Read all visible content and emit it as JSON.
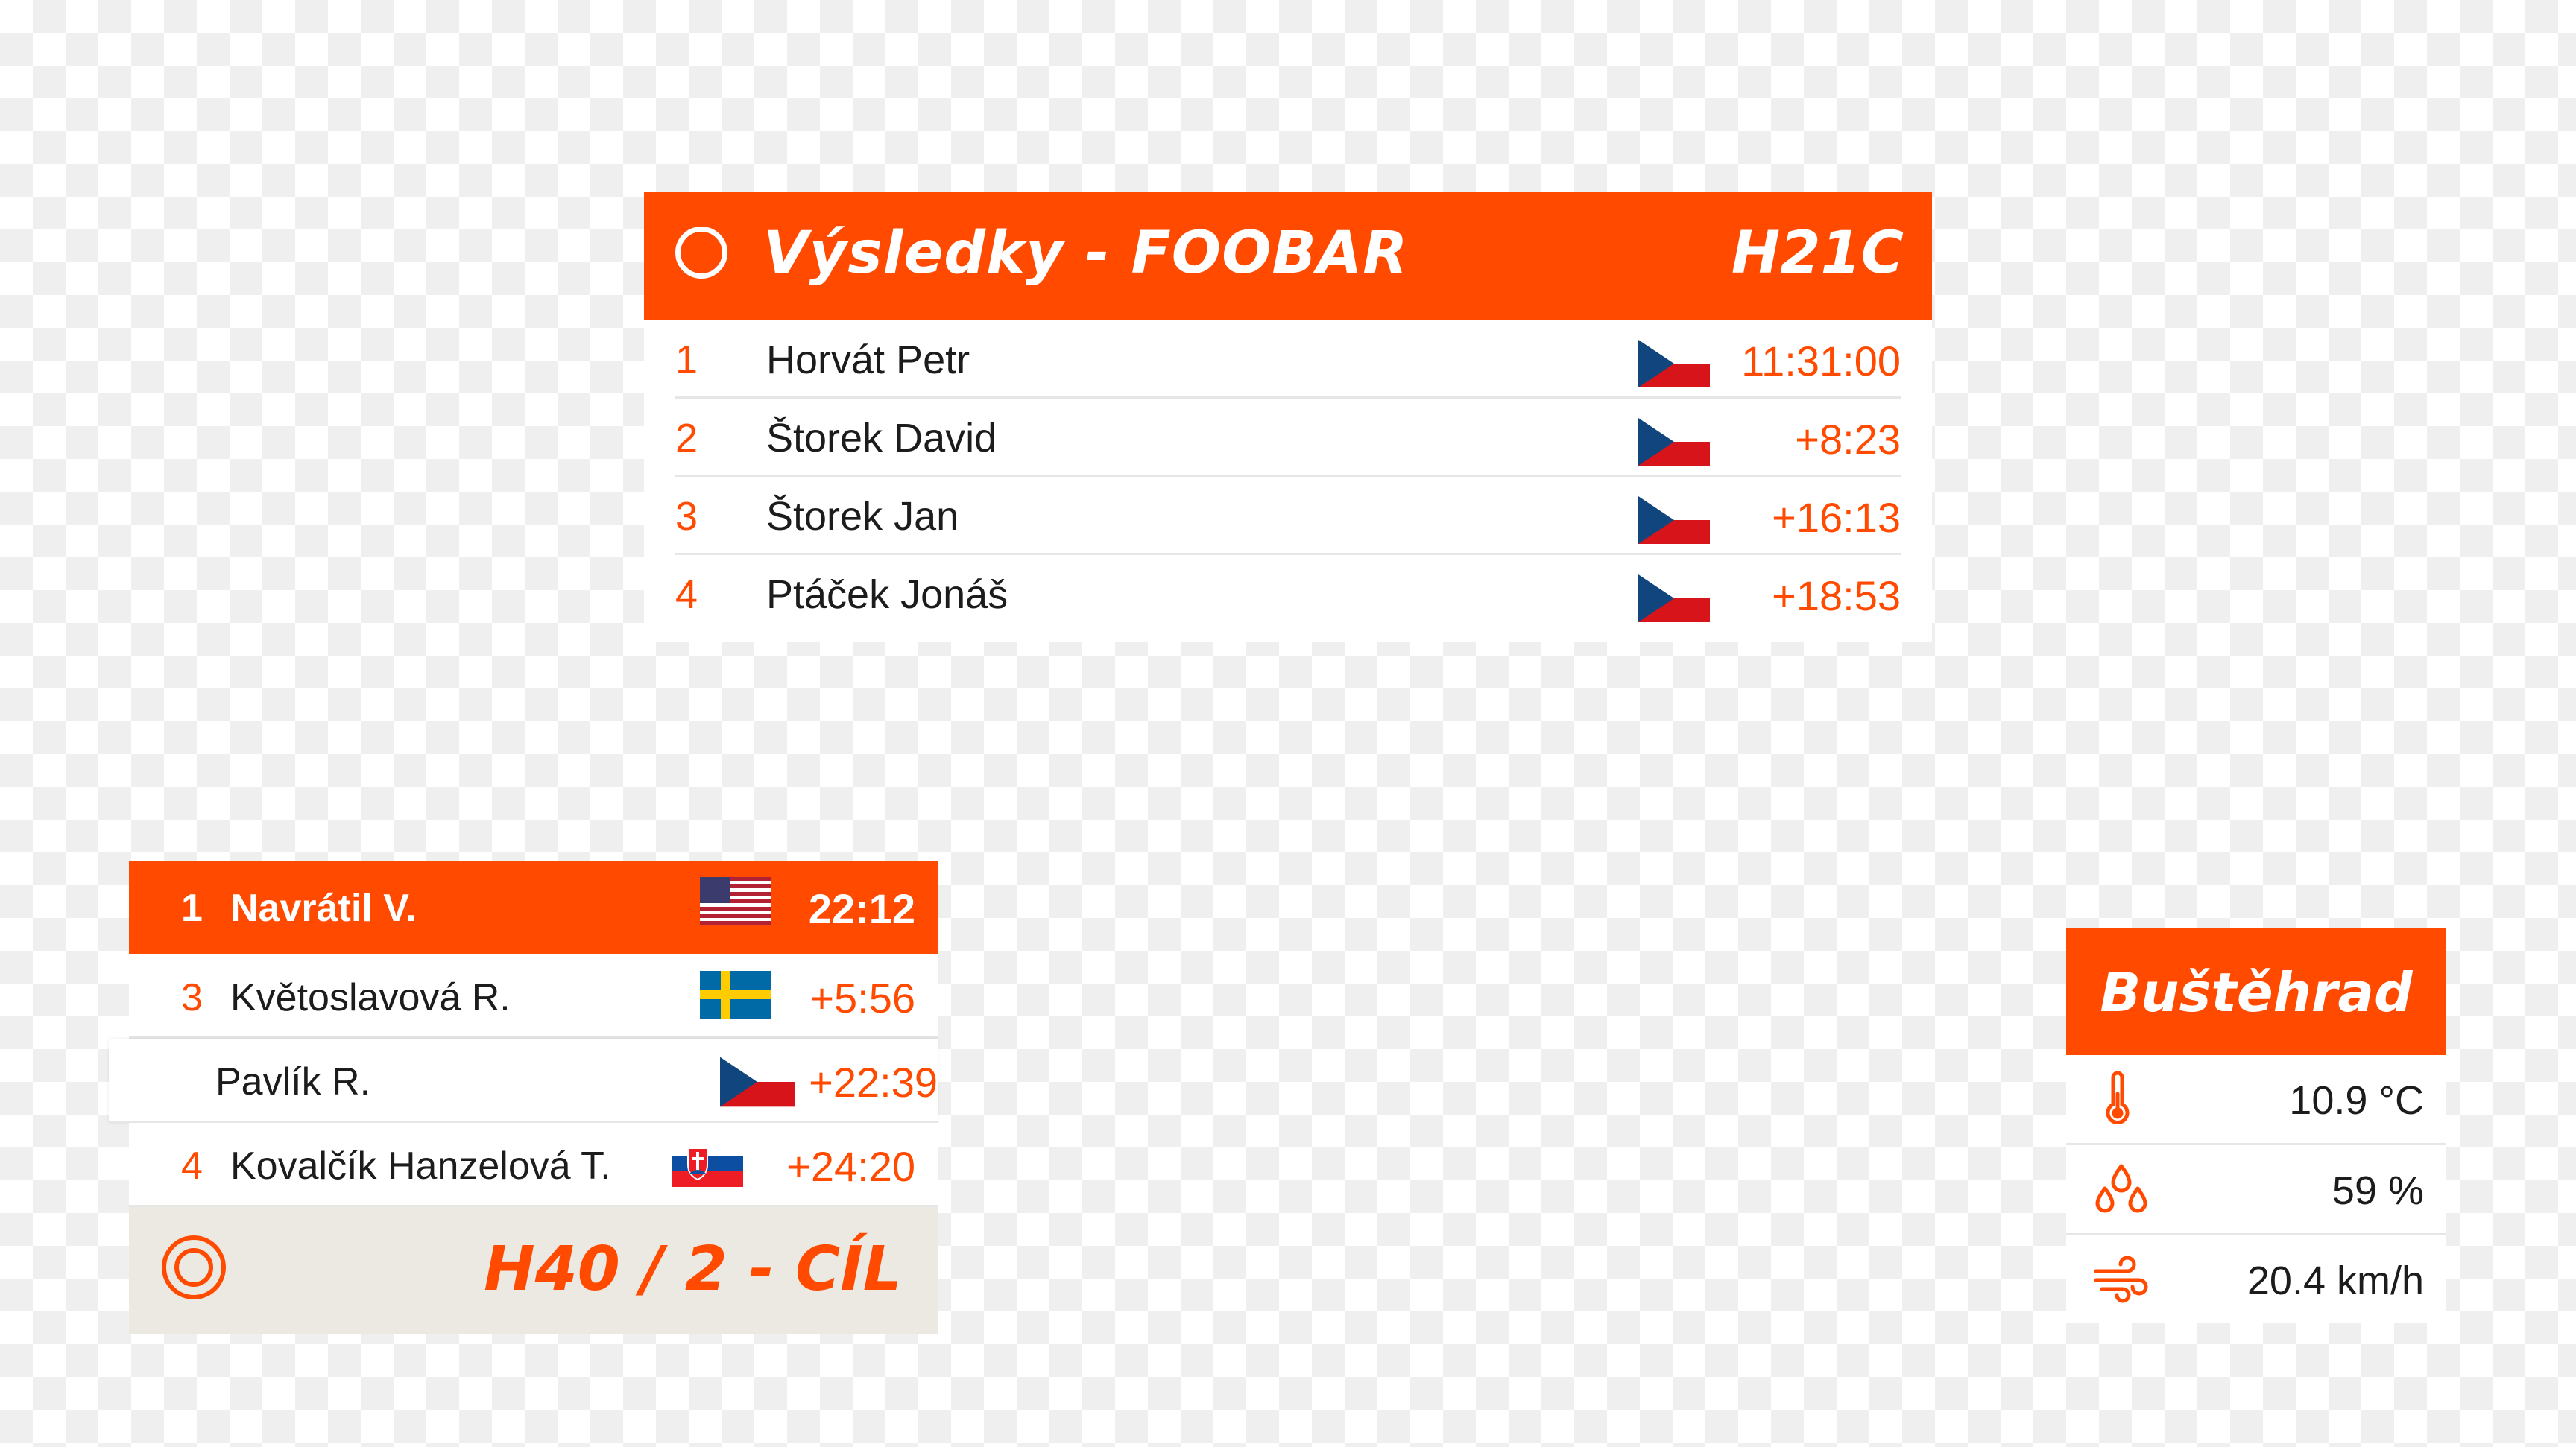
{
  "results": {
    "title": "Výsledky - FOOBAR",
    "category": "H21C",
    "rows": [
      {
        "rank": "1",
        "name": "Horvát Petr",
        "flag": "czech-flag",
        "time": "11:31:00"
      },
      {
        "rank": "2",
        "name": "Štorek David",
        "flag": "czech-flag",
        "time": "+8:23"
      },
      {
        "rank": "3",
        "name": "Štorek Jan",
        "flag": "czech-flag",
        "time": "+16:13"
      },
      {
        "rank": "4",
        "name": "Ptáček Jonáš",
        "flag": "czech-flag",
        "time": "+18:53"
      }
    ]
  },
  "leaderboard": {
    "rows": [
      {
        "rank": "1",
        "name": "Navrátil V.",
        "flag": "usa-flag",
        "time": "22:12"
      },
      {
        "rank": "3",
        "name": "Květoslavová R.",
        "flag": "sweden-flag",
        "time": "+5:56"
      },
      {
        "rank": "",
        "name": "Pavlík R.",
        "flag": "czech-flag",
        "time": "+22:39"
      },
      {
        "rank": "4",
        "name": "Kovalčík Hanzelová T.",
        "flag": "slovakia-flag",
        "time": "+24:20"
      }
    ],
    "footer_label": "H40 / 2 - CÍL",
    "footer_icon": "target-icon"
  },
  "weather": {
    "location": "Buštěhrad",
    "temperature": "10.9 °C",
    "humidity": "59 %",
    "wind": "20.4 km/h",
    "icons": [
      "thermometer-icon",
      "droplets-icon",
      "wind-icon"
    ]
  },
  "colors": {
    "accent": "#ff4a00",
    "footer_bg": "#ebe9e2",
    "text": "#1c1c1c"
  }
}
